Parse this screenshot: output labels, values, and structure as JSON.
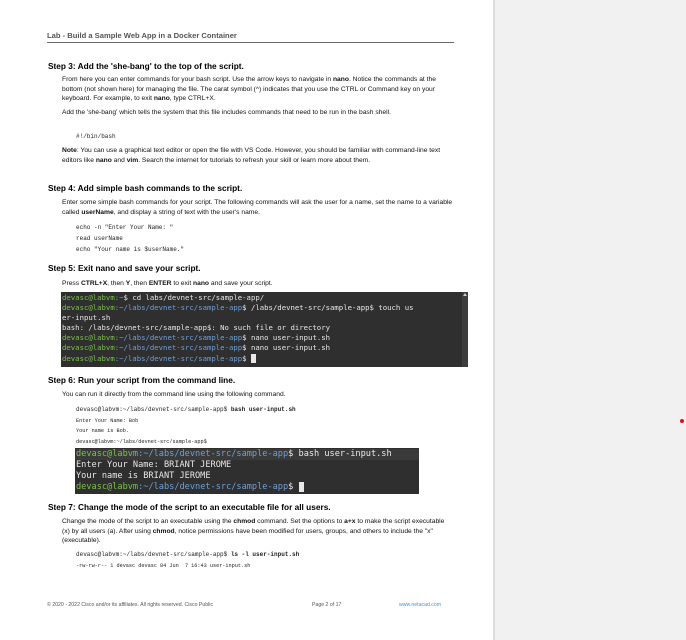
{
  "header": {
    "title": "Lab - Build a Sample Web App in a Docker Container"
  },
  "step3": {
    "heading": "Step 3: Add the 'she-bang' to the top of the script.",
    "para1_a": "From here you can enter commands for your bash script. Use the arrow keys to navigate in ",
    "para1_b": "nano",
    "para1_c": ". Notice the commands at the bottom (not shown here) for managing the file. The carat symbol (^) indicates that you use the CTRL or Command key on your keyboard. For example, to exit ",
    "para1_d": "nano",
    "para1_e": ", type CTRL+X.",
    "para2": "Add the 'she-bang' which tells the system that this file includes commands that need to be run in the bash shell.",
    "code": "#!/bin/bash",
    "note_a": "Note",
    "note_b": ": You can use a graphical text editor or open the file with VS Code. However, you should be familiar with command-line text editors like ",
    "note_c": "nano",
    "note_d": " and ",
    "note_e": "vim",
    "note_f": ". Search the internet for tutorials to refresh your skill or learn more about them."
  },
  "step4": {
    "heading": "Step 4: Add simple bash commands to the script.",
    "para_a": "Enter some simple bash commands for your script. The following commands will ask the user for a name, set the name to a variable called ",
    "para_b": "userName",
    "para_c": ", and display a string of text with the user's name.",
    "code": [
      "echo -n \"Enter Your Name: \"",
      "read userName",
      "echo \"Your name is $userName.\""
    ]
  },
  "step5": {
    "heading": "Step 5: Exit nano and save your script.",
    "para_a": "Press ",
    "para_b": "CTRL+X",
    "para_c": ", then ",
    "para_d": "Y",
    "para_e": ", then ",
    "para_f": "ENTER",
    "para_g": " to exit ",
    "para_h": "nano",
    "para_i": " and save your script.",
    "terminal": {
      "user": "devasc@labvm",
      "lines": [
        {
          "path": "~",
          "cmd": "cd labs/devnet-src/sample-app/"
        },
        {
          "path": "~/labs/devnet-src/sample-app",
          "cmd": "/labs/devnet-src/sample-app$ touch us"
        },
        {
          "plain": "er-input.sh"
        },
        {
          "plain": "bash: /labs/devnet-src/sample-app$: No such file or directory"
        },
        {
          "path": "~/labs/devnet-src/sample-app",
          "cmd": "nano user-input.sh"
        },
        {
          "path": "~/labs/devnet-src/sample-app",
          "cmd": "nano user-input.sh"
        },
        {
          "path": "~/labs/devnet-src/sample-app",
          "cmd": ""
        }
      ]
    }
  },
  "step6": {
    "heading": "Step 6: Run your script from the command line.",
    "para": "You can run it directly from the command line using the following command.",
    "code_a1": "devasc@labvm:~/labs/devnet-src/sample-app$ ",
    "code_a2": "bash user-input.sh",
    "code_b": "Enter Your Name: Bob",
    "code_c": "Your name is Bob.",
    "code_d": "devasc@labvm:~/labs/devnet-src/sample-app$",
    "terminal": {
      "user": "devasc@labvm",
      "path": "~/labs/devnet-src/sample-app",
      "cmd": "bash user-input.sh",
      "out1": "Enter Your Name: BRIANT JEROME",
      "out2": "Your name is BRIANT JEROME"
    }
  },
  "step7": {
    "heading": "Step 7: Change the mode of the script to an executable file for all users.",
    "para_a": "Change the mode of the script to an executable using the ",
    "para_b": "chmod",
    "para_c": " command. Set the options to ",
    "para_d": "a+x",
    "para_e": " to make the script executable (x) by all users (a). After using ",
    "para_f": "chmod",
    "para_g": ", notice permissions have been modified for users, groups, and others to include the \"x\" (executable).",
    "code_a1": "devasc@labvm:~/labs/devnet-src/sample-app$ ",
    "code_a2": "ls -l user-input.sh",
    "code_b": "-rw-rw-r-- 1 devasc devasc 84 Jun  7 16:43 user-input.sh"
  },
  "footer": {
    "copyright": "© 2020 - 2022 Cisco and/or its affiliates. All rights reserved. Cisco Public",
    "page": "Page 2 of 17",
    "url": "www.netacad.com"
  },
  "colors": {
    "terminal_bg": "#2f2f2f",
    "prompt_user": "#79c24a",
    "prompt_path": "#6f9fd8",
    "link": "#4a90d9",
    "red_dot": "#d11"
  }
}
